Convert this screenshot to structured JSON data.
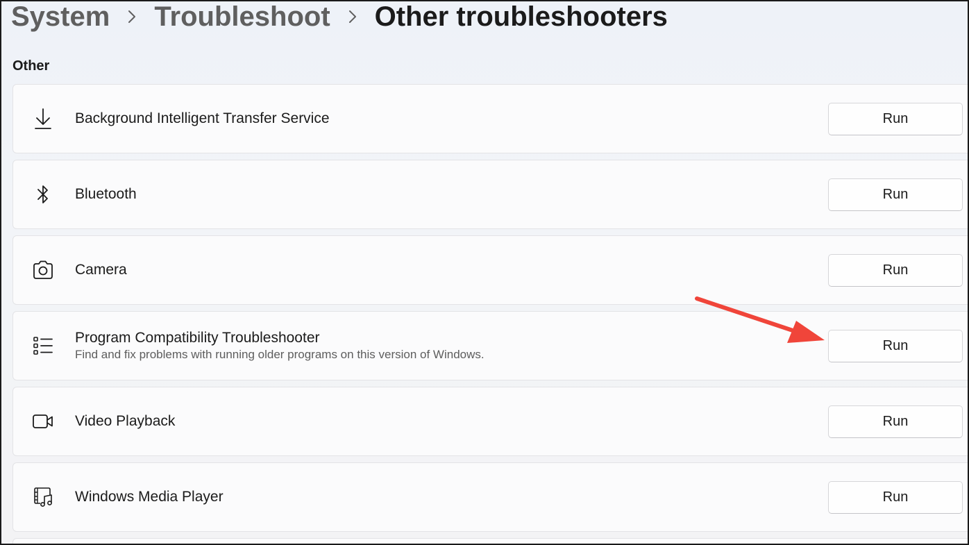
{
  "breadcrumb": {
    "items": [
      "System",
      "Troubleshoot",
      "Other troubleshooters"
    ]
  },
  "section": {
    "title": "Other"
  },
  "troubleshooters": [
    {
      "title": "Background Intelligent Transfer Service",
      "description": "",
      "icon": "download-icon",
      "button": "Run"
    },
    {
      "title": "Bluetooth",
      "description": "",
      "icon": "bluetooth-icon",
      "button": "Run"
    },
    {
      "title": "Camera",
      "description": "",
      "icon": "camera-icon",
      "button": "Run"
    },
    {
      "title": "Program Compatibility Troubleshooter",
      "description": "Find and fix problems with running older programs on this version of Windows.",
      "icon": "list-icon",
      "button": "Run"
    },
    {
      "title": "Video Playback",
      "description": "",
      "icon": "video-camera-icon",
      "button": "Run"
    },
    {
      "title": "Windows Media Player",
      "description": "",
      "icon": "media-player-icon",
      "button": "Run"
    }
  ],
  "colors": {
    "annotation_arrow": "#f0453a",
    "page_background": "#f0f3f9",
    "card_background": "#fbfbfc"
  }
}
